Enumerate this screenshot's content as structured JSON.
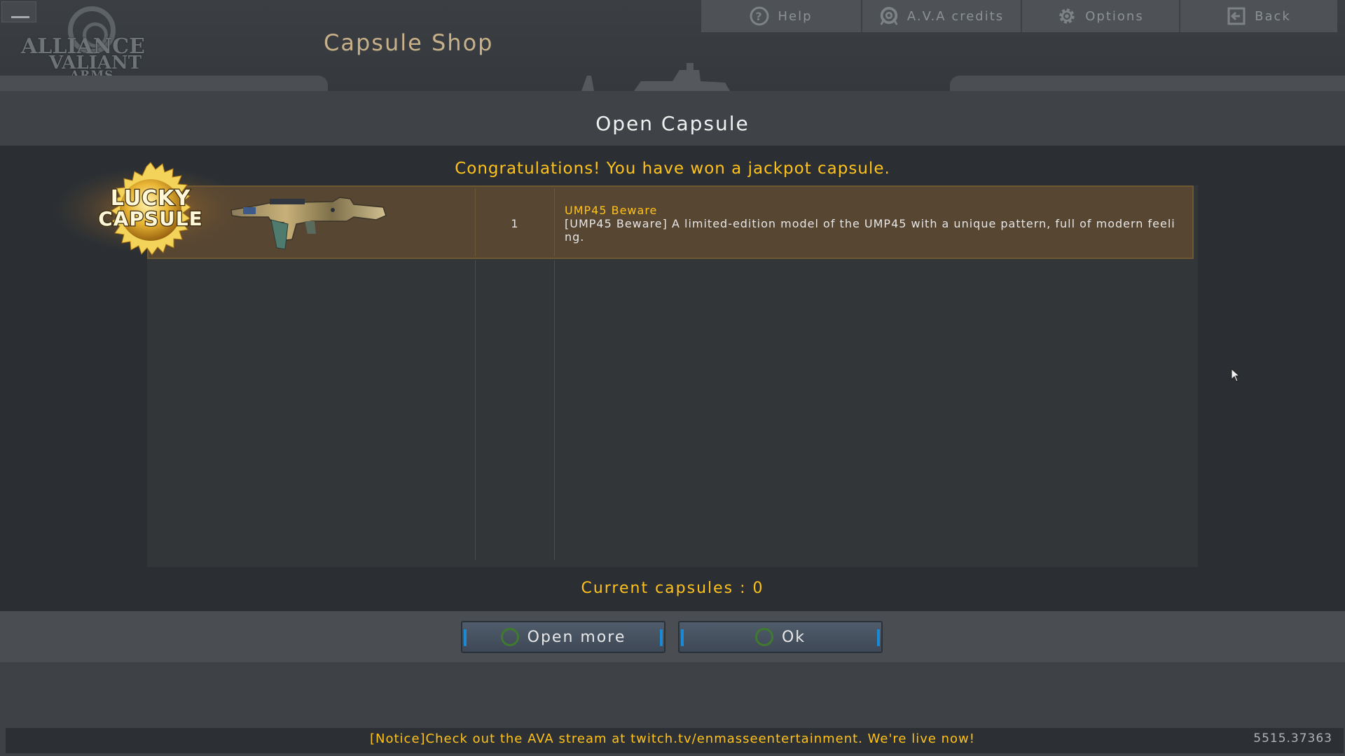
{
  "header": {
    "logo_line1": "ALLIANCE",
    "logo_line2": "VALIANT",
    "logo_line3": "ARMS",
    "page_title": "Capsule Shop",
    "nav": [
      {
        "label": "Help",
        "icon": "help-icon"
      },
      {
        "label": "A.V.A credits",
        "icon": "credits-icon"
      },
      {
        "label": "Options",
        "icon": "gear-icon"
      },
      {
        "label": "Back",
        "icon": "back-arrow-icon"
      }
    ]
  },
  "dialog": {
    "title": "Open Capsule",
    "congrats": "Congratulations! You have won a jackpot capsule.",
    "badge_line1": "LUCKY",
    "badge_line2": "CAPSULE",
    "item": {
      "quantity": "1",
      "name": "UMP45 Beware",
      "description": "[UMP45 Beware] A limited-edition model of the UMP45 with a unique pattern, full of modern feeling."
    },
    "current_capsules": "Current capsules : 0",
    "buttons": {
      "open_more": "Open more",
      "ok": "Ok"
    }
  },
  "footer": {
    "notice": "[Notice]Check out the AVA stream at twitch.tv/enmasseentertainment. We're live now!",
    "coords": "5515.37363"
  },
  "colors": {
    "accent_gold": "#ffc21a",
    "title_tan": "#c8b088",
    "row_highlight": "#574632",
    "button_blue": "#1a8ad6"
  }
}
